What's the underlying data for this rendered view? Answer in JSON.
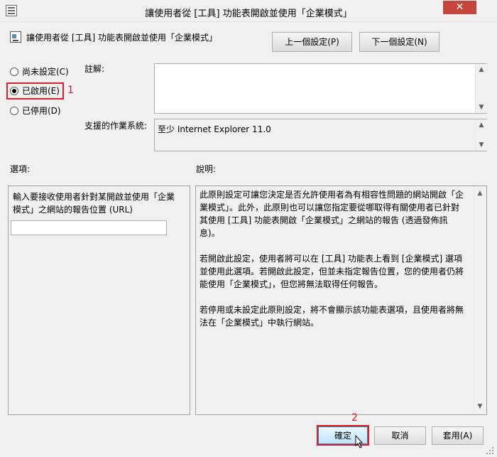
{
  "window": {
    "title": "讓使用者從 [工具] 功能表開啟並使用「企業模式」",
    "close_glyph": "✕"
  },
  "policy": {
    "name": "讓使用者從 [工具] 功能表開啟並使用「企業模式」",
    "prev_button": "上一個設定(P)",
    "next_button": "下一個設定(N)"
  },
  "state": {
    "options": [
      {
        "label": "尚未設定(C)",
        "selected": false
      },
      {
        "label": "已啟用(E)",
        "selected": true
      },
      {
        "label": "已停用(D)",
        "selected": false
      }
    ]
  },
  "comment": {
    "label": "註解:",
    "value": ""
  },
  "supported": {
    "label": "支援的作業系統:",
    "value": "至少 Internet Explorer 11.0"
  },
  "options_section": {
    "label": "選項:",
    "description": "輸入要接收使用者針對某開啟並使用「企業模式」之網站的報告位置 (URL)",
    "url_value": ""
  },
  "help_section": {
    "label": "說明:",
    "paragraphs": [
      "此原則設定可讓您決定是否允許使用者為有相容性問題的網站開啟「企業模式」。此外，此原則也可以讓您指定要從哪取得有關使用者已針對其使用 [工具] 功能表開啟「企業模式」之網站的報告 (透過發佈訊息)。",
      "若開啟此設定，使用者將可以在 [工具] 功能表上看到 [企業模式] 選項並使用此選項。若開啟此設定，但並未指定報告位置，您的使用者仍將能使用「企業模式」，但您將無法取得任何報告。",
      "若停用或未設定此原則設定，將不會顯示該功能表選項，且使用者將無法在「企業模式」中執行網站。"
    ]
  },
  "buttons": {
    "ok": "確定",
    "cancel": "取消",
    "apply": "套用(A)"
  },
  "annotations": {
    "step1": "1",
    "step2": "2",
    "color": "#e11c2c"
  }
}
